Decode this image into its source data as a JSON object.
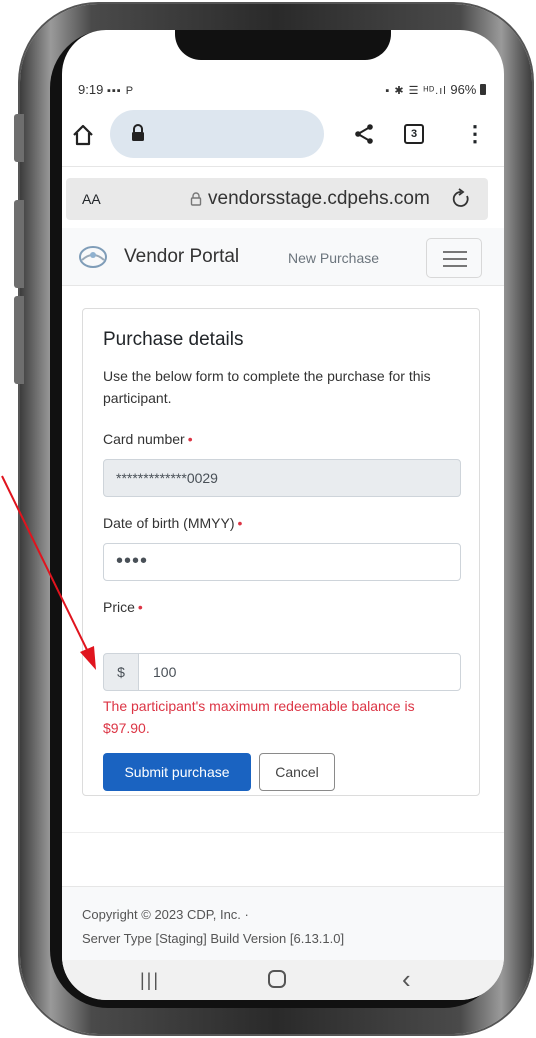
{
  "status_bar": {
    "time": "9:19",
    "left_glyphs": "▪▪▪ P",
    "right_glyphs": "▪ ✱ ☰ ᴴᴰ.ıl",
    "battery": "96%"
  },
  "browser": {
    "tab_count": "3",
    "text_size_label": "AA",
    "url": "vendorsstage.cdpehs.com"
  },
  "navbar": {
    "brand": "Vendor Portal",
    "link": "New Purchase"
  },
  "form": {
    "title": "Purchase details",
    "description": "Use the below form to complete the purchase for this participant.",
    "card_label": "Card number",
    "card_value": "*************0029",
    "dob_label": "Date of birth (MMYY)",
    "dob_value": "••••",
    "price_label": "Price",
    "price_prefix": "$",
    "price_value": "100",
    "required_mark": "•",
    "error": "The participant's maximum redeemable balance is $97.90.",
    "submit_label": "Submit purchase",
    "cancel_label": "Cancel"
  },
  "footer": {
    "copyright": "Copyright © 2023 CDP, Inc. ·",
    "server": "Server Type [Staging] Build Version [6.13.1.0]"
  },
  "colors": {
    "primary": "#1a63c1",
    "danger": "#dc3545",
    "annotation_arrow": "#e0141e"
  }
}
